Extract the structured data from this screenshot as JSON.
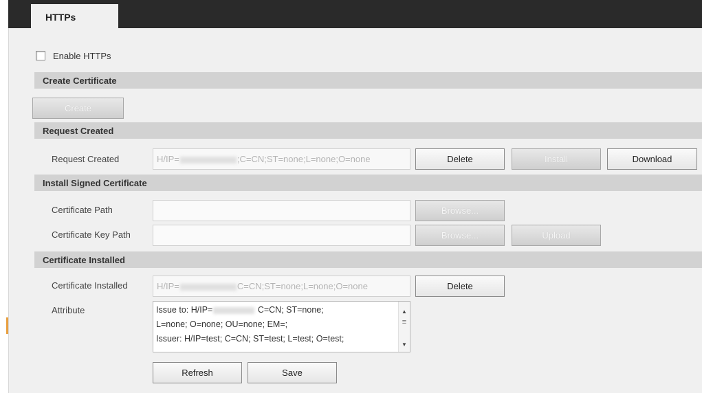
{
  "tabs": {
    "active": "HTTPs"
  },
  "enable_https": {
    "label": "Enable HTTPs",
    "checked": false
  },
  "create_certificate": {
    "section_title": "Create Certificate",
    "create_button": "Create"
  },
  "request_created": {
    "section_title": "Request Created",
    "row_label": "Request Created",
    "value_prefix": "H/IP=",
    "value_suffix": ";C=CN;ST=none;L=none;O=none",
    "delete_button": "Delete",
    "install_button": "Install",
    "download_button": "Download"
  },
  "install_signed": {
    "section_title": "Install Signed Certificate",
    "cert_path_label": "Certificate Path",
    "cert_path_value": "",
    "key_path_label": "Certificate Key Path",
    "key_path_value": "",
    "browse_button": "Browse...",
    "browse_button_2": "Browse...",
    "upload_button": "Upload"
  },
  "certificate_installed": {
    "section_title": "Certificate Installed",
    "row_label": "Certificate Installed",
    "value_prefix": "H/IP=",
    "value_suffix": "C=CN;ST=none;L=none;O=none",
    "delete_button": "Delete",
    "attribute_label": "Attribute",
    "attribute_lines": [
      {
        "prefix": "Issue to: H/IP=",
        "suffix": " C=CN; ST=none;"
      },
      {
        "text": "L=none; O=none; OU=none; EM=;"
      },
      {
        "text": "Issuer: H/IP=test; C=CN; ST=test; L=test; O=test;"
      }
    ]
  },
  "footer": {
    "refresh_button": "Refresh",
    "save_button": "Save"
  },
  "colors": {
    "tabbar": "#2a2a2a",
    "section": "#d2d2d2",
    "page_bg": "#f0f0f0",
    "accent": "#e8a040"
  }
}
